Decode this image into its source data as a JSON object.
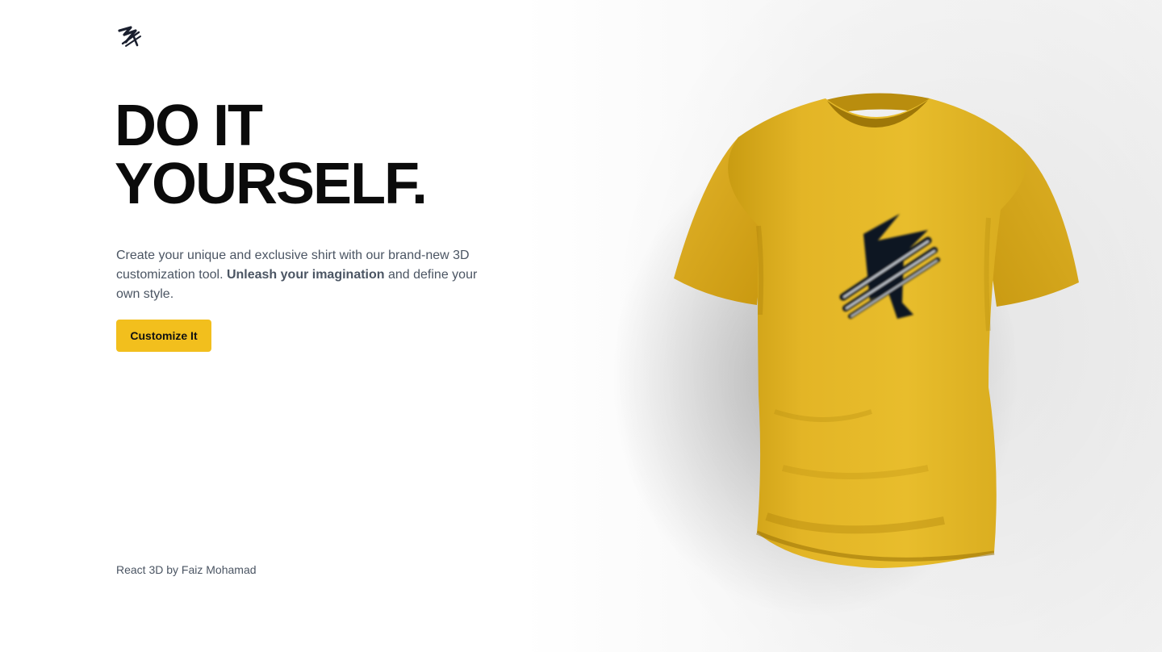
{
  "hero": {
    "headline_line1": "DO IT",
    "headline_line2": "YOURSELF.",
    "description_part1": "Create your unique and exclusive shirt with our brand-new 3D customization tool. ",
    "description_bold": "Unleash your imagination",
    "description_part2": " and define your own style.",
    "cta_label": "Customize It"
  },
  "footer": {
    "credit": "React 3D by Faiz Mohamad"
  },
  "shirt": {
    "color": "#e7bb2a",
    "decal_icon": "brand-logo-icon"
  },
  "colors": {
    "accent": "#f2bf1d",
    "text_dark": "#0b0b0b",
    "text_muted": "#4b5563"
  }
}
